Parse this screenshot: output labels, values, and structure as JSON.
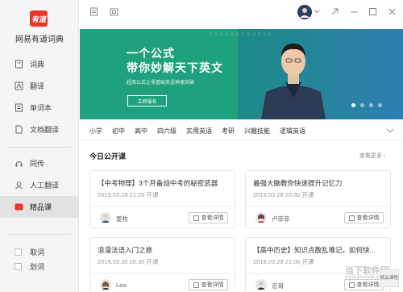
{
  "app": {
    "name": "网易有道词典",
    "logo_text": "有道"
  },
  "sidebar": {
    "items": [
      {
        "label": "词典",
        "icon": "dictionary-icon"
      },
      {
        "label": "翻译",
        "icon": "translate-icon"
      },
      {
        "label": "单词本",
        "icon": "wordbook-icon"
      },
      {
        "label": "文档翻译",
        "icon": "doc-translate-icon"
      },
      {
        "label": "同传",
        "icon": "interpret-icon"
      },
      {
        "label": "人工翻译",
        "icon": "human-translate-icon"
      },
      {
        "label": "精品课",
        "icon": "course-icon"
      }
    ],
    "bottom": [
      {
        "label": "取词"
      },
      {
        "label": "划词"
      }
    ]
  },
  "banner": {
    "line1": "一个公式",
    "line2": "带你妙解天下英文",
    "sub": "超简公式让零基础英语神速突破",
    "cta": "立即报名",
    "deco": "YOUDAOCOURSE"
  },
  "categories": [
    "小学",
    "初中",
    "高中",
    "四六级",
    "实用英语",
    "考研",
    "兴趣技能",
    "逻辑英语"
  ],
  "section": {
    "title": "今日公开课",
    "more": "查看更多 ›"
  },
  "cards": [
    {
      "title": "【中考物理】3个月备战中考的秘密武器",
      "time": "2019.03.28 21:20 开课",
      "teacher": "姜牧",
      "detail": "查看详情"
    },
    {
      "title": "最强大脑教你快速提升记忆力",
      "time": "2019.03.28 20:30 开课",
      "teacher": "卢菲菲",
      "detail": "查看详情"
    },
    {
      "title": "浪漫法语入门之旅",
      "time": "2019.03.30 20:30 开课",
      "teacher": "Lea",
      "detail": "查看详情"
    },
    {
      "title": "【高中历史】知识点散乱难记，如何快...",
      "time": "2019.03.29 21:00 开课",
      "teacher": "宏哥",
      "detail": "查看详情"
    }
  ],
  "watermark": {
    "text": "当下软件园",
    "url": "www.downxia.com",
    "badge": "精品课程"
  },
  "colors": {
    "brand": "#e7352b",
    "banner": "#1fa17d"
  }
}
